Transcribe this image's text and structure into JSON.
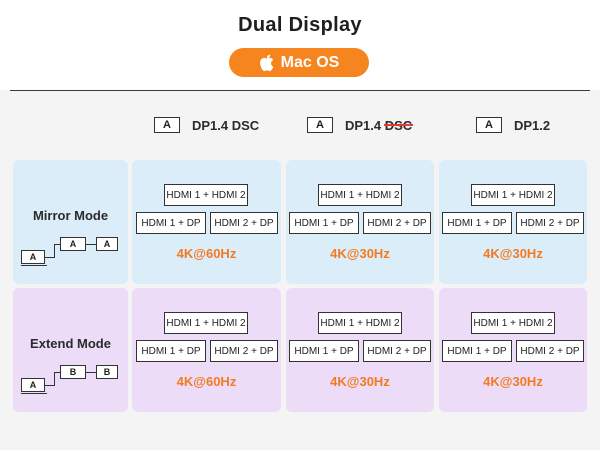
{
  "header": {
    "title": "Dual Display",
    "os_badge": "Mac OS"
  },
  "columns": [
    {
      "monitor_label": "A",
      "name": "DP1.4 DSC",
      "prefix": "",
      "struck": ""
    },
    {
      "monitor_label": "A",
      "name": "",
      "prefix": "DP1.4 ",
      "struck": "DSC"
    },
    {
      "monitor_label": "A",
      "name": "DP1.2",
      "prefix": "",
      "struck": ""
    }
  ],
  "rows": [
    {
      "label": "Mirror Mode",
      "diagram": {
        "laptop": "A",
        "mon1": "A",
        "mon2": "A"
      },
      "cells": [
        {
          "top": "HDMI 1 + HDMI 2",
          "left": "HDMI 1 + DP",
          "right": "HDMI 2 + DP",
          "resolution": "4K@60Hz"
        },
        {
          "top": "HDMI 1 + HDMI 2",
          "left": "HDMI 1 + DP",
          "right": "HDMI 2 + DP",
          "resolution": "4K@30Hz"
        },
        {
          "top": "HDMI 1 + HDMI 2",
          "left": "HDMI 1 + DP",
          "right": "HDMI 2 + DP",
          "resolution": "4K@30Hz"
        }
      ]
    },
    {
      "label": "Extend Mode",
      "diagram": {
        "laptop": "A",
        "mon1": "B",
        "mon2": "B"
      },
      "cells": [
        {
          "top": "HDMI 1 + HDMI 2",
          "left": "HDMI 1 + DP",
          "right": "HDMI 2 + DP",
          "resolution": "4K@60Hz"
        },
        {
          "top": "HDMI 1 + HDMI 2",
          "left": "HDMI 1 + DP",
          "right": "HDMI 2 + DP",
          "resolution": "4K@30Hz"
        },
        {
          "top": "HDMI 1 + HDMI 2",
          "left": "HDMI 1 + DP",
          "right": "HDMI 2 + DP",
          "resolution": "4K@30Hz"
        }
      ]
    }
  ],
  "colors": {
    "accent": "#f6851f",
    "mirror_bg": "#dcedfa",
    "extend_bg": "#ecdcf8",
    "resolution_text": "#f47a20"
  }
}
